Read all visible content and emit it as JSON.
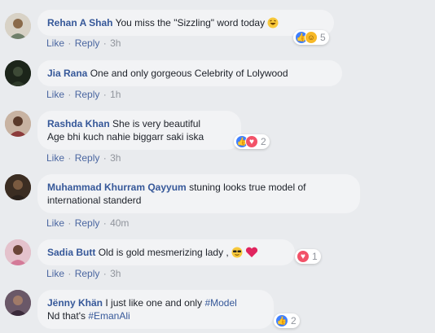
{
  "comments": [
    {
      "name": "Rehan A Shah",
      "text": "You miss the \"Sizzling\" word today",
      "like": "Like",
      "reply": "Reply",
      "time": "3h",
      "reactions": [
        "like-icon",
        "haha-icon"
      ],
      "count": "5"
    },
    {
      "name": "Jia Rana",
      "text": "One and only gorgeous Celebrity of Lolywood",
      "like": "Like",
      "reply": "Reply",
      "time": "1h"
    },
    {
      "name": "Rashda Khan",
      "text": "She is very beautiful",
      "text2": "Age bhi kuch nahie biggarr saki iska",
      "like": "Like",
      "reply": "Reply",
      "time": "3h",
      "reactions": [
        "like-icon",
        "love-icon"
      ],
      "count": "2"
    },
    {
      "name": "Muhammad Khurram Qayyum",
      "text": "stuning looks true model of",
      "text2": "international standerd",
      "like": "Like",
      "reply": "Reply",
      "time": "40m"
    },
    {
      "name": "Sadia Butt",
      "text": "Old is gold mesmerizing lady ,",
      "like": "Like",
      "reply": "Reply",
      "time": "3h",
      "reactions": [
        "love-icon"
      ],
      "count": "1"
    },
    {
      "name": "Jënny Khän",
      "text": "I just like one and only",
      "hashtag1": "#Model",
      "text2": "Nd that's",
      "hashtag2": "#EmanAli",
      "reactions": [
        "like-icon"
      ],
      "count": "2"
    }
  ],
  "separator": "·",
  "colors": {
    "background": "#e9ebee",
    "bubble": "#f2f3f5",
    "name_link": "#365899",
    "meta": "#90949c",
    "like_reaction": "#4080ff",
    "love_reaction": "#f25268",
    "haha_reaction": "#f7b928"
  }
}
